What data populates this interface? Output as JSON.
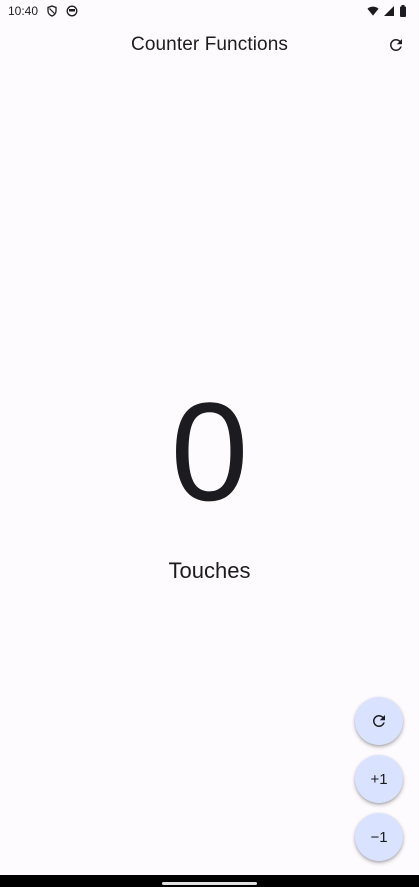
{
  "status_bar": {
    "time": "10:40",
    "icons": [
      "shield-icon",
      "cat-icon",
      "wifi-icon",
      "signal-icon",
      "battery-icon"
    ]
  },
  "app_bar": {
    "title": "Counter Functions",
    "action_icon": "refresh-icon"
  },
  "counter": {
    "value": "0",
    "label": "Touches"
  },
  "fabs": {
    "reset_icon": "refresh-icon",
    "increment_label": "+1",
    "decrement_label": "−1"
  },
  "colors": {
    "background": "#fefbff",
    "fab": "#d9e3ff",
    "text": "#1c1b1f"
  }
}
